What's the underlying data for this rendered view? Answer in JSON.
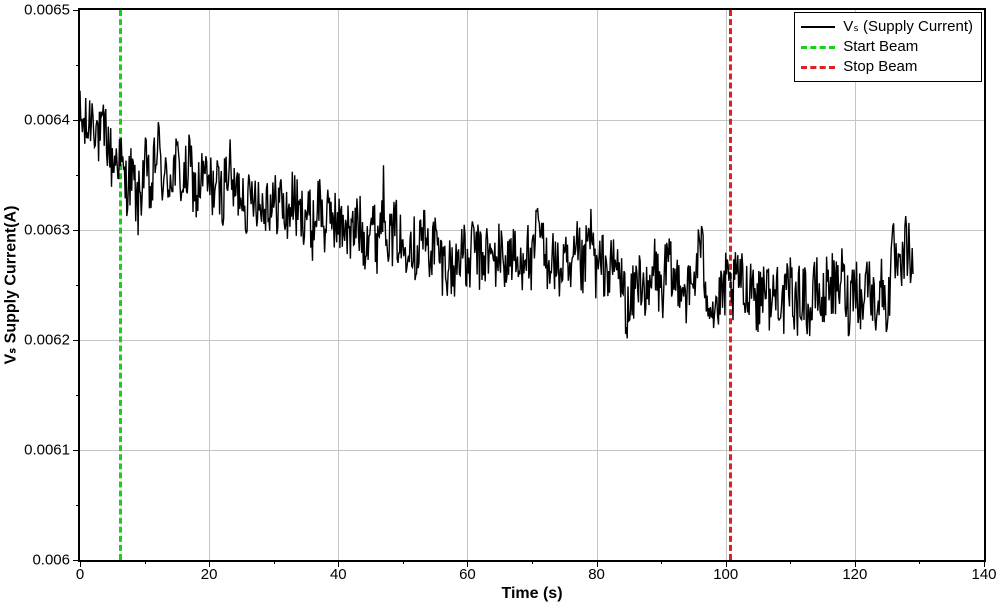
{
  "chart_data": {
    "type": "line",
    "xlabel": "Time (s)",
    "ylabel": "Vₛ Supply Current(A)",
    "xlim": [
      0,
      140
    ],
    "ylim": [
      0.006,
      0.0065
    ],
    "xticks_major": [
      0,
      20,
      40,
      60,
      80,
      100,
      120,
      140
    ],
    "xticks_minor": [
      10,
      30,
      50,
      70,
      90,
      110,
      130
    ],
    "yticks_major": [
      0.006,
      0.0061,
      0.0062,
      0.0063,
      0.0064,
      0.0065
    ],
    "yticks_minor": [
      0.00605,
      0.00615,
      0.00625,
      0.00635,
      0.00645
    ],
    "events": [
      {
        "name": "Start Beam",
        "x": 6.0,
        "color": "#18d018"
      },
      {
        "name": "Stop Beam",
        "x": 100.5,
        "color": "#e02020"
      }
    ],
    "series": [
      {
        "name": "Vₛ (Supply Current)",
        "color": "#000000",
        "x": [
          0,
          1,
          2,
          3,
          4,
          5,
          6,
          7,
          8,
          9,
          10,
          11,
          12,
          13,
          14,
          15,
          16,
          17,
          18,
          19,
          20,
          21,
          22,
          23,
          24,
          25,
          26,
          27,
          28,
          29,
          30,
          31,
          32,
          33,
          34,
          35,
          36,
          37,
          38,
          39,
          40,
          41,
          42,
          43,
          44,
          45,
          46,
          47,
          48,
          49,
          50,
          51,
          52,
          53,
          54,
          55,
          56,
          57,
          58,
          59,
          60,
          61,
          62,
          63,
          64,
          65,
          66,
          67,
          68,
          69,
          70,
          71,
          72,
          73,
          74,
          75,
          76,
          77,
          78,
          79,
          80,
          81,
          82,
          83,
          84,
          85,
          86,
          87,
          88,
          89,
          90,
          91,
          92,
          93,
          94,
          95,
          96,
          97,
          98,
          99,
          100,
          101,
          102,
          103,
          104,
          105,
          106,
          107,
          108,
          109,
          110,
          111,
          112,
          113,
          114,
          115,
          116,
          117,
          118,
          119,
          120,
          121,
          122,
          123,
          124,
          125,
          126,
          127,
          128,
          129
        ],
        "y": [
          0.0064,
          0.00639,
          0.00641,
          0.00638,
          0.00639,
          0.00636,
          0.00637,
          0.00634,
          0.00635,
          0.00632,
          0.00636,
          0.00633,
          0.00638,
          0.00634,
          0.00635,
          0.00636,
          0.00634,
          0.00636,
          0.00633,
          0.00635,
          0.00634,
          0.00634,
          0.00633,
          0.00636,
          0.00633,
          0.00634,
          0.00632,
          0.00634,
          0.00632,
          0.00633,
          0.00632,
          0.00633,
          0.00631,
          0.00633,
          0.00631,
          0.00632,
          0.0063,
          0.00633,
          0.0063,
          0.00632,
          0.0063,
          0.00631,
          0.00629,
          0.00631,
          0.00629,
          0.00631,
          0.00629,
          0.00633,
          0.00629,
          0.0063,
          0.00628,
          0.0063,
          0.00628,
          0.0063,
          0.00628,
          0.00629,
          0.00627,
          0.00627,
          0.00626,
          0.00629,
          0.00626,
          0.00629,
          0.00627,
          0.00628,
          0.00627,
          0.00628,
          0.00627,
          0.00628,
          0.00626,
          0.00629,
          0.00626,
          0.00631,
          0.00627,
          0.00628,
          0.00626,
          0.00627,
          0.00625,
          0.00628,
          0.00626,
          0.0063,
          0.00626,
          0.00627,
          0.00626,
          0.00627,
          0.00625,
          0.00622,
          0.00625,
          0.00626,
          0.00623,
          0.00627,
          0.00624,
          0.00627,
          0.00625,
          0.00626,
          0.00624,
          0.00625,
          0.00629,
          0.00625,
          0.00623,
          0.00623,
          0.00625,
          0.00624,
          0.00626,
          0.00624,
          0.00626,
          0.00623,
          0.00626,
          0.00623,
          0.00625,
          0.00623,
          0.00625,
          0.00623,
          0.00625,
          0.00622,
          0.00625,
          0.00623,
          0.00626,
          0.00624,
          0.00626,
          0.00623,
          0.00626,
          0.00623,
          0.00626,
          0.00623,
          0.00625,
          0.00623,
          0.00628,
          0.00625,
          0.00629,
          0.00626
        ],
        "noise_amp": 3e-05
      }
    ],
    "legend": {
      "entries": [
        {
          "label": "Vₛ (Supply Current)",
          "style": "solid",
          "color": "#000000"
        },
        {
          "label": "Start Beam",
          "style": "dash",
          "color": "#18d018"
        },
        {
          "label": "Stop Beam",
          "style": "dash",
          "color": "#e02020"
        }
      ]
    }
  }
}
